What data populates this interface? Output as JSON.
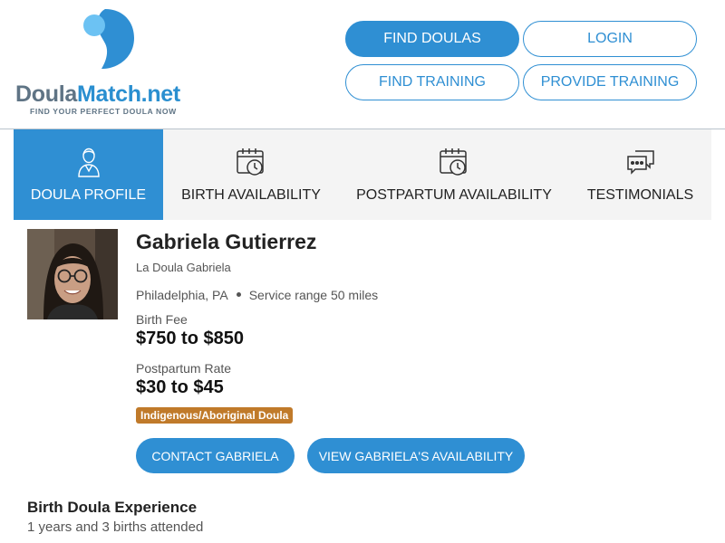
{
  "brand": {
    "name_part1": "Doula",
    "name_part2": "Match.net",
    "tagline": "FIND YOUR PERFECT DOULA NOW",
    "colors": {
      "primary": "#2f8fd3",
      "logo_gray": "#5f7485",
      "badge": "#c07a2a"
    }
  },
  "nav": {
    "find_doulas": "FIND DOULAS",
    "login": "LOGIN",
    "find_training": "FIND TRAINING",
    "provide_training": "PROVIDE TRAINING"
  },
  "tabs": [
    {
      "label": "DOULA PROFILE",
      "icon": "doula-person-icon",
      "active": true
    },
    {
      "label": "BIRTH AVAILABILITY",
      "icon": "calendar-clock-icon",
      "active": false
    },
    {
      "label": "POSTPARTUM AVAILABILITY",
      "icon": "calendar-clock-icon",
      "active": false
    },
    {
      "label": "TESTIMONIALS",
      "icon": "chat-bubbles-icon",
      "active": false
    }
  ],
  "profile": {
    "name": "Gabriela Gutierrez",
    "business": "La Doula Gabriela",
    "location": "Philadelphia, PA",
    "service_range": "Service range 50 miles",
    "birth_fee_label": "Birth Fee",
    "birth_fee_value": "$750 to $850",
    "postpartum_label": "Postpartum Rate",
    "postpartum_value": "$30 to $45",
    "badge": "Indigenous/Aboriginal Doula",
    "contact_button": "CONTACT GABRIELA",
    "availability_button": "VIEW GABRIELA'S AVAILABILITY"
  },
  "experience": {
    "title": "Birth Doula Experience",
    "text": "1 years and 3 births attended"
  }
}
